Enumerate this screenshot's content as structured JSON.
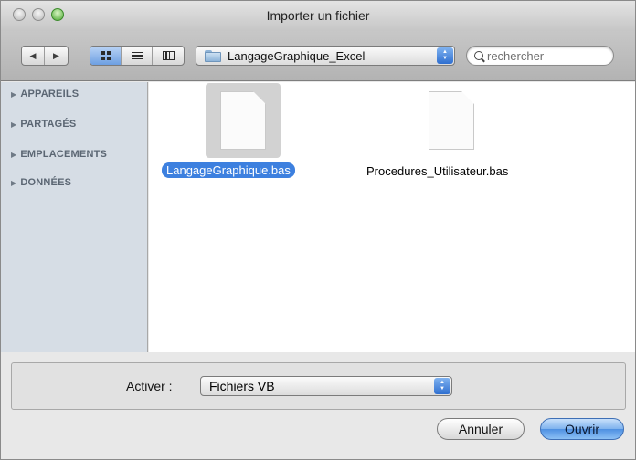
{
  "window": {
    "title": "Importer un fichier"
  },
  "toolbar": {
    "back_glyph": "◀",
    "forward_glyph": "▶",
    "location": "LangageGraphique_Excel",
    "search_placeholder": "rechercher"
  },
  "sidebar": {
    "items": [
      {
        "label": "APPAREILS"
      },
      {
        "label": "PARTAGÉS"
      },
      {
        "label": "EMPLACEMENTS"
      },
      {
        "label": "DONNÉES"
      }
    ]
  },
  "files": [
    {
      "name": "LangageGraphique.bas",
      "selected": true
    },
    {
      "name": "Procedures_Utilisateur.bas",
      "selected": false
    }
  ],
  "options": {
    "activate_label": "Activer :",
    "filter_value": "Fichiers VB"
  },
  "buttons": {
    "cancel": "Annuler",
    "open": "Ouvrir"
  },
  "colors": {
    "selection": "#3d80df",
    "sidebar_bg": "#d6dde5",
    "accent_button": "#4e90e2"
  }
}
